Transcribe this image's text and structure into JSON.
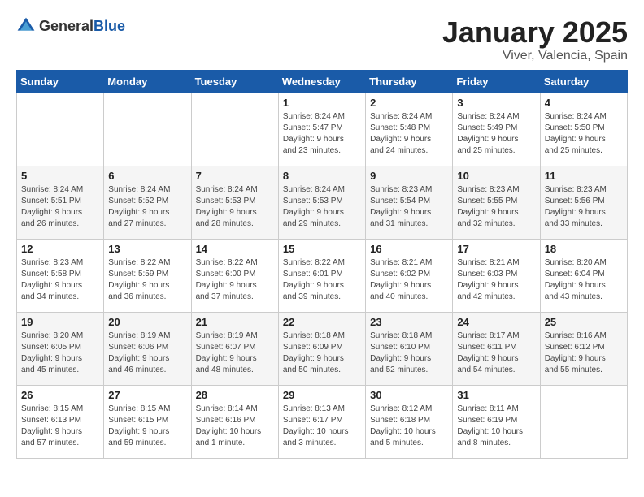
{
  "logo": {
    "general": "General",
    "blue": "Blue"
  },
  "title": "January 2025",
  "location": "Viver, Valencia, Spain",
  "weekdays": [
    "Sunday",
    "Monday",
    "Tuesday",
    "Wednesday",
    "Thursday",
    "Friday",
    "Saturday"
  ],
  "weeks": [
    [
      {
        "day": "",
        "info": ""
      },
      {
        "day": "",
        "info": ""
      },
      {
        "day": "",
        "info": ""
      },
      {
        "day": "1",
        "info": "Sunrise: 8:24 AM\nSunset: 5:47 PM\nDaylight: 9 hours\nand 23 minutes."
      },
      {
        "day": "2",
        "info": "Sunrise: 8:24 AM\nSunset: 5:48 PM\nDaylight: 9 hours\nand 24 minutes."
      },
      {
        "day": "3",
        "info": "Sunrise: 8:24 AM\nSunset: 5:49 PM\nDaylight: 9 hours\nand 25 minutes."
      },
      {
        "day": "4",
        "info": "Sunrise: 8:24 AM\nSunset: 5:50 PM\nDaylight: 9 hours\nand 25 minutes."
      }
    ],
    [
      {
        "day": "5",
        "info": "Sunrise: 8:24 AM\nSunset: 5:51 PM\nDaylight: 9 hours\nand 26 minutes."
      },
      {
        "day": "6",
        "info": "Sunrise: 8:24 AM\nSunset: 5:52 PM\nDaylight: 9 hours\nand 27 minutes."
      },
      {
        "day": "7",
        "info": "Sunrise: 8:24 AM\nSunset: 5:53 PM\nDaylight: 9 hours\nand 28 minutes."
      },
      {
        "day": "8",
        "info": "Sunrise: 8:24 AM\nSunset: 5:53 PM\nDaylight: 9 hours\nand 29 minutes."
      },
      {
        "day": "9",
        "info": "Sunrise: 8:23 AM\nSunset: 5:54 PM\nDaylight: 9 hours\nand 31 minutes."
      },
      {
        "day": "10",
        "info": "Sunrise: 8:23 AM\nSunset: 5:55 PM\nDaylight: 9 hours\nand 32 minutes."
      },
      {
        "day": "11",
        "info": "Sunrise: 8:23 AM\nSunset: 5:56 PM\nDaylight: 9 hours\nand 33 minutes."
      }
    ],
    [
      {
        "day": "12",
        "info": "Sunrise: 8:23 AM\nSunset: 5:58 PM\nDaylight: 9 hours\nand 34 minutes."
      },
      {
        "day": "13",
        "info": "Sunrise: 8:22 AM\nSunset: 5:59 PM\nDaylight: 9 hours\nand 36 minutes."
      },
      {
        "day": "14",
        "info": "Sunrise: 8:22 AM\nSunset: 6:00 PM\nDaylight: 9 hours\nand 37 minutes."
      },
      {
        "day": "15",
        "info": "Sunrise: 8:22 AM\nSunset: 6:01 PM\nDaylight: 9 hours\nand 39 minutes."
      },
      {
        "day": "16",
        "info": "Sunrise: 8:21 AM\nSunset: 6:02 PM\nDaylight: 9 hours\nand 40 minutes."
      },
      {
        "day": "17",
        "info": "Sunrise: 8:21 AM\nSunset: 6:03 PM\nDaylight: 9 hours\nand 42 minutes."
      },
      {
        "day": "18",
        "info": "Sunrise: 8:20 AM\nSunset: 6:04 PM\nDaylight: 9 hours\nand 43 minutes."
      }
    ],
    [
      {
        "day": "19",
        "info": "Sunrise: 8:20 AM\nSunset: 6:05 PM\nDaylight: 9 hours\nand 45 minutes."
      },
      {
        "day": "20",
        "info": "Sunrise: 8:19 AM\nSunset: 6:06 PM\nDaylight: 9 hours\nand 46 minutes."
      },
      {
        "day": "21",
        "info": "Sunrise: 8:19 AM\nSunset: 6:07 PM\nDaylight: 9 hours\nand 48 minutes."
      },
      {
        "day": "22",
        "info": "Sunrise: 8:18 AM\nSunset: 6:09 PM\nDaylight: 9 hours\nand 50 minutes."
      },
      {
        "day": "23",
        "info": "Sunrise: 8:18 AM\nSunset: 6:10 PM\nDaylight: 9 hours\nand 52 minutes."
      },
      {
        "day": "24",
        "info": "Sunrise: 8:17 AM\nSunset: 6:11 PM\nDaylight: 9 hours\nand 54 minutes."
      },
      {
        "day": "25",
        "info": "Sunrise: 8:16 AM\nSunset: 6:12 PM\nDaylight: 9 hours\nand 55 minutes."
      }
    ],
    [
      {
        "day": "26",
        "info": "Sunrise: 8:15 AM\nSunset: 6:13 PM\nDaylight: 9 hours\nand 57 minutes."
      },
      {
        "day": "27",
        "info": "Sunrise: 8:15 AM\nSunset: 6:15 PM\nDaylight: 9 hours\nand 59 minutes."
      },
      {
        "day": "28",
        "info": "Sunrise: 8:14 AM\nSunset: 6:16 PM\nDaylight: 10 hours\nand 1 minute."
      },
      {
        "day": "29",
        "info": "Sunrise: 8:13 AM\nSunset: 6:17 PM\nDaylight: 10 hours\nand 3 minutes."
      },
      {
        "day": "30",
        "info": "Sunrise: 8:12 AM\nSunset: 6:18 PM\nDaylight: 10 hours\nand 5 minutes."
      },
      {
        "day": "31",
        "info": "Sunrise: 8:11 AM\nSunset: 6:19 PM\nDaylight: 10 hours\nand 8 minutes."
      },
      {
        "day": "",
        "info": ""
      }
    ]
  ]
}
